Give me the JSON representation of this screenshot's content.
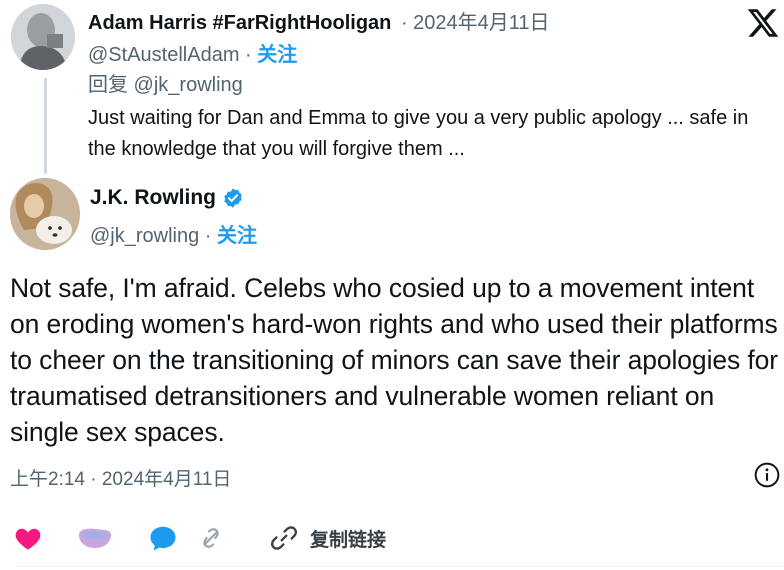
{
  "reply_tweet": {
    "name": "Adam Harris #FarRightHooligan",
    "date": "· 2024年4月11日",
    "handle": "@StAustellAdam ·",
    "follow_label": "关注",
    "reply_to_label": "回复 @jk_rowling",
    "body": "Just waiting for Dan and Emma to give you a very public apology ... safe in the knowledge that you will forgive them ..."
  },
  "main_tweet": {
    "name": "J.K. Rowling",
    "handle": "@jk_rowling ·",
    "follow_label": "关注",
    "body": "Not safe, I'm afraid. Celebs who cosied up to a movement intent on eroding women's hard-won rights and who used their platforms to cheer on the transitioning of minors can save their apologies for traumatised detransitioners and vulnerable women reliant on single sex spaces.",
    "timestamp": "上午2:14 · 2024年4月11日"
  },
  "actions": {
    "copy_link_label": "复制链接"
  },
  "icons": {
    "brand": "x-logo-icon",
    "verified": "verified-badge-icon",
    "info": "info-icon",
    "like": "heart-icon",
    "reply": "reply-bubble-icon",
    "share": "share-icon",
    "copy_link": "link-icon"
  },
  "colors": {
    "accent": "#1d9bf0",
    "like": "#f91880",
    "secondary_text": "#536471",
    "thread_line": "#cfd9de"
  }
}
